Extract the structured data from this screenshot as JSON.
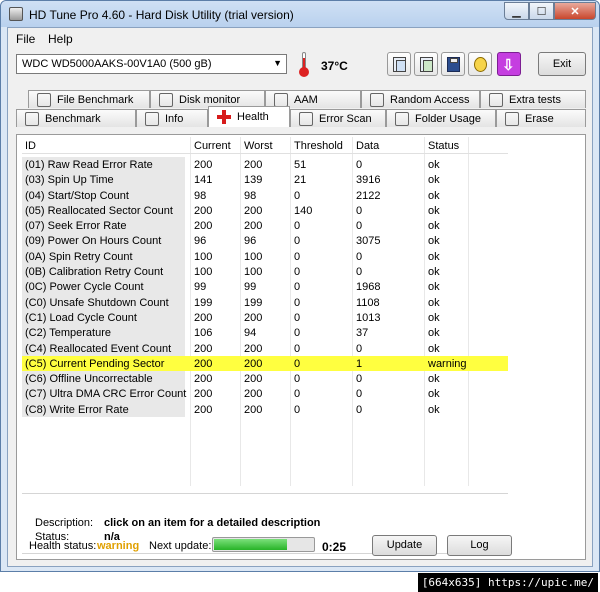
{
  "window": {
    "title": "HD Tune Pro 4.60 - Hard Disk Utility (trial version)",
    "min_label": "▁",
    "max_label": "☐",
    "close_label": "✕"
  },
  "menu": {
    "file": "File",
    "help": "Help"
  },
  "toolbar": {
    "drive": "WDC WD5000AAKS-00V1A0 (500 gB)",
    "temperature": "37°C",
    "exit": "Exit",
    "icons": [
      "copy-icon",
      "copy-all-icon",
      "save-icon",
      "options-icon",
      "purple-arrow-icon"
    ]
  },
  "tabs": {
    "row1": [
      {
        "label": "File Benchmark",
        "icon": "file-benchmark-icon"
      },
      {
        "label": "Disk monitor",
        "icon": "disk-monitor-icon"
      },
      {
        "label": "AAM",
        "icon": "speaker-icon"
      },
      {
        "label": "Random Access",
        "icon": "random-access-icon"
      },
      {
        "label": "Extra tests",
        "icon": "extra-tests-icon"
      }
    ],
    "row2": [
      {
        "label": "Benchmark",
        "icon": "benchmark-icon"
      },
      {
        "label": "Info",
        "icon": "info-icon"
      },
      {
        "label": "Health",
        "icon": "health-cross-icon"
      },
      {
        "label": "Error Scan",
        "icon": "error-scan-icon"
      },
      {
        "label": "Folder Usage",
        "icon": "folder-icon"
      },
      {
        "label": "Erase",
        "icon": "trash-icon"
      }
    ]
  },
  "table": {
    "columns": [
      "ID",
      "Current",
      "Worst",
      "Threshold",
      "Data",
      "Status"
    ],
    "rows": [
      [
        "(01) Raw Read Error Rate",
        "200",
        "200",
        "51",
        "0",
        "ok"
      ],
      [
        "(03) Spin Up Time",
        "141",
        "139",
        "21",
        "3916",
        "ok"
      ],
      [
        "(04) Start/Stop Count",
        "98",
        "98",
        "0",
        "2122",
        "ok"
      ],
      [
        "(05) Reallocated Sector Count",
        "200",
        "200",
        "140",
        "0",
        "ok"
      ],
      [
        "(07) Seek Error Rate",
        "200",
        "200",
        "0",
        "0",
        "ok"
      ],
      [
        "(09) Power On Hours Count",
        "96",
        "96",
        "0",
        "3075",
        "ok"
      ],
      [
        "(0A) Spin Retry Count",
        "100",
        "100",
        "0",
        "0",
        "ok"
      ],
      [
        "(0B) Calibration Retry Count",
        "100",
        "100",
        "0",
        "0",
        "ok"
      ],
      [
        "(0C) Power Cycle Count",
        "99",
        "99",
        "0",
        "1968",
        "ok"
      ],
      [
        "(C0) Unsafe Shutdown Count",
        "199",
        "199",
        "0",
        "1108",
        "ok"
      ],
      [
        "(C1) Load Cycle Count",
        "200",
        "200",
        "0",
        "1013",
        "ok"
      ],
      [
        "(C2) Temperature",
        "106",
        "94",
        "0",
        "37",
        "ok"
      ],
      [
        "(C4) Reallocated Event Count",
        "200",
        "200",
        "0",
        "0",
        "ok"
      ],
      [
        "(C5) Current Pending Sector",
        "200",
        "200",
        "0",
        "1",
        "warning"
      ],
      [
        "(C6) Offline Uncorrectable",
        "200",
        "200",
        "0",
        "0",
        "ok"
      ],
      [
        "(C7) Ultra DMA CRC Error Count",
        "200",
        "200",
        "0",
        "0",
        "ok"
      ],
      [
        "(C8) Write Error Rate",
        "200",
        "200",
        "0",
        "0",
        "ok"
      ]
    ],
    "highlight_color": "#ffff40"
  },
  "description": {
    "label": "Description:",
    "value": "click on an item for a detailed description",
    "status_label": "Status:",
    "status_value": "n/a"
  },
  "footer": {
    "health_label": "Health status:",
    "health_value": "warning",
    "health_color": "#e0a000",
    "next_update_label": "Next update:",
    "progress_fraction": 0.72,
    "countdown": "0:25",
    "update_button": "Update",
    "log_button": "Log"
  },
  "watermark": "[664x635] https://upic.me/"
}
